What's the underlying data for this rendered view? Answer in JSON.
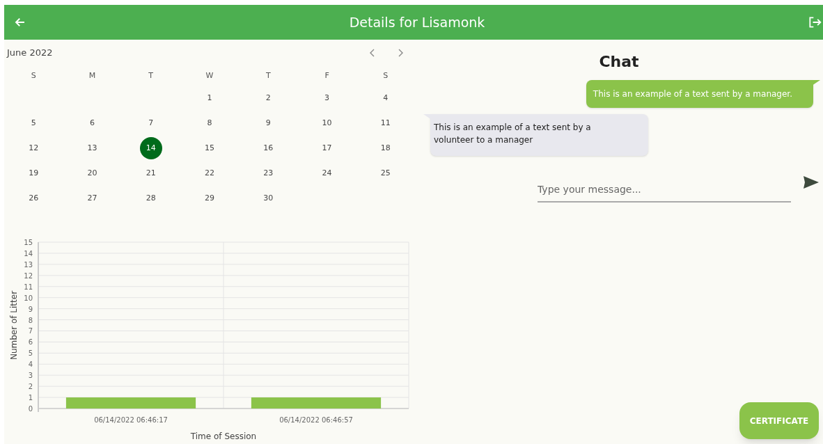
{
  "header": {
    "title": "Details for Lisamonk"
  },
  "calendar": {
    "month": "June 2022",
    "weekdays": [
      "S",
      "M",
      "T",
      "W",
      "T",
      "F",
      "S"
    ],
    "weeks": [
      [
        {
          "day": "1",
          "selected": false
        },
        {
          "day": "2",
          "selected": false
        },
        {
          "day": "3",
          "selected": false
        },
        {
          "day": "4",
          "selected": false
        }
      ],
      [
        {
          "day": "5",
          "selected": false
        },
        {
          "day": "6",
          "selected": false
        },
        {
          "day": "7",
          "selected": false
        },
        {
          "day": "8",
          "selected": false
        },
        {
          "day": "9",
          "selected": false
        },
        {
          "day": "10",
          "selected": false
        },
        {
          "day": "11",
          "selected": false
        }
      ],
      [
        {
          "day": "12",
          "selected": false
        },
        {
          "day": "13",
          "selected": false
        },
        {
          "day": "14",
          "selected": true
        },
        {
          "day": "15",
          "selected": false
        },
        {
          "day": "16",
          "selected": false
        },
        {
          "day": "17",
          "selected": false
        },
        {
          "day": "18",
          "selected": false
        }
      ],
      [
        {
          "day": "19",
          "selected": false
        },
        {
          "day": "20",
          "selected": false
        },
        {
          "day": "21",
          "selected": false
        },
        {
          "day": "22",
          "selected": false
        },
        {
          "day": "23",
          "selected": false
        },
        {
          "day": "24",
          "selected": false
        },
        {
          "day": "25",
          "selected": false
        }
      ],
      [
        {
          "day": "26",
          "selected": false
        },
        {
          "day": "27",
          "selected": false
        },
        {
          "day": "28",
          "selected": false
        },
        {
          "day": "29",
          "selected": false
        },
        {
          "day": "30",
          "selected": false
        }
      ]
    ]
  },
  "chart": {
    "chart_data": {
      "type": "bar",
      "xlabel": "Time of Session",
      "ylabel": "Number of Litter",
      "categories": [
        "06/14/2022 06:46:17",
        "06/14/2022 06:46:57"
      ],
      "series": [
        {
          "color": "#8bc34a",
          "values": [
            1,
            1
          ]
        }
      ],
      "ylim": [
        0,
        15
      ],
      "grid": true,
      "yticks": [
        {
          "value": 0,
          "label": "0"
        },
        {
          "value": 1,
          "label": "1"
        },
        {
          "value": 2,
          "label": "2"
        },
        {
          "value": 3,
          "label": "3"
        },
        {
          "value": 4,
          "label": "4"
        },
        {
          "value": 5,
          "label": "5"
        },
        {
          "value": 6,
          "label": "6"
        },
        {
          "value": 7,
          "label": "7"
        },
        {
          "value": 8,
          "label": "8"
        },
        {
          "value": 9,
          "label": "9"
        },
        {
          "value": 10,
          "label": "10"
        },
        {
          "value": 11,
          "label": "11"
        },
        {
          "value": 12,
          "label": "12"
        },
        {
          "value": 13,
          "label": "13"
        },
        {
          "value": 14,
          "label": "14"
        },
        {
          "value": 15,
          "label": "15"
        }
      ]
    }
  },
  "chat": {
    "title": "Chat",
    "messages": [
      {
        "kind": "sent",
        "text": "This is an example of a text sent by a manager."
      },
      {
        "kind": "received",
        "text": "This is an example of a text sent by a volunteer to a manager"
      }
    ],
    "input": {
      "placeholder": "Type your message..."
    }
  },
  "certificate_button": "CERTIFICATE"
}
